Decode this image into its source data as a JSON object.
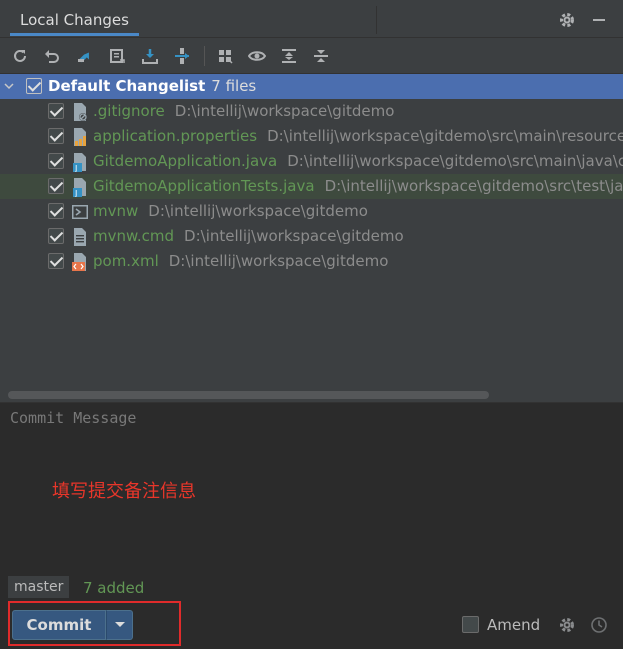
{
  "header": {
    "tab_label": "Local Changes"
  },
  "toolbar": {
    "icons": [
      "refresh-icon",
      "rollback-icon",
      "show-diff-icon",
      "changelist-icon",
      "shelve-icon",
      "merge-icon",
      "group-by-icon",
      "preview-icon",
      "expand-all-icon",
      "collapse-all-icon"
    ]
  },
  "changelist": {
    "name": "Default Changelist",
    "count": "7 files",
    "files": [
      {
        "name": ".gitignore",
        "path": "D:\\intellij\\workspace\\gitdemo",
        "icon": "gitignore-file-icon",
        "icon_color": "#9aa7b0"
      },
      {
        "name": "application.properties",
        "path": "D:\\intellij\\workspace\\gitdemo\\src\\main\\resource",
        "icon": "properties-file-icon",
        "icon_color": "#e8a33e"
      },
      {
        "name": "GitdemoApplication.java",
        "path": "D:\\intellij\\workspace\\gitdemo\\src\\main\\java\\c",
        "icon": "java-file-icon",
        "icon_color": "#3592c4"
      },
      {
        "name": "GitdemoApplicationTests.java",
        "path": "D:\\intellij\\workspace\\gitdemo\\src\\test\\ja",
        "icon": "java-file-icon",
        "icon_color": "#3592c4"
      },
      {
        "name": "mvnw",
        "path": "D:\\intellij\\workspace\\gitdemo",
        "icon": "shell-script-icon",
        "icon_color": "#9aa7b0"
      },
      {
        "name": "mvnw.cmd",
        "path": "D:\\intellij\\workspace\\gitdemo",
        "icon": "text-file-icon",
        "icon_color": "#9aa7b0"
      },
      {
        "name": "pom.xml",
        "path": "D:\\intellij\\workspace\\gitdemo",
        "icon": "xml-file-icon",
        "icon_color": "#e8754a"
      }
    ]
  },
  "commit": {
    "placeholder": "Commit Message",
    "annotation": "填写提交备注信息",
    "branch": "master",
    "status": "7 added",
    "commit_label": "Commit",
    "amend_label": "Amend"
  },
  "colors": {
    "accent": "#4b6eaf",
    "added_green": "#629755",
    "annotation_red": "#e8362a",
    "commit_button": "#365880"
  }
}
